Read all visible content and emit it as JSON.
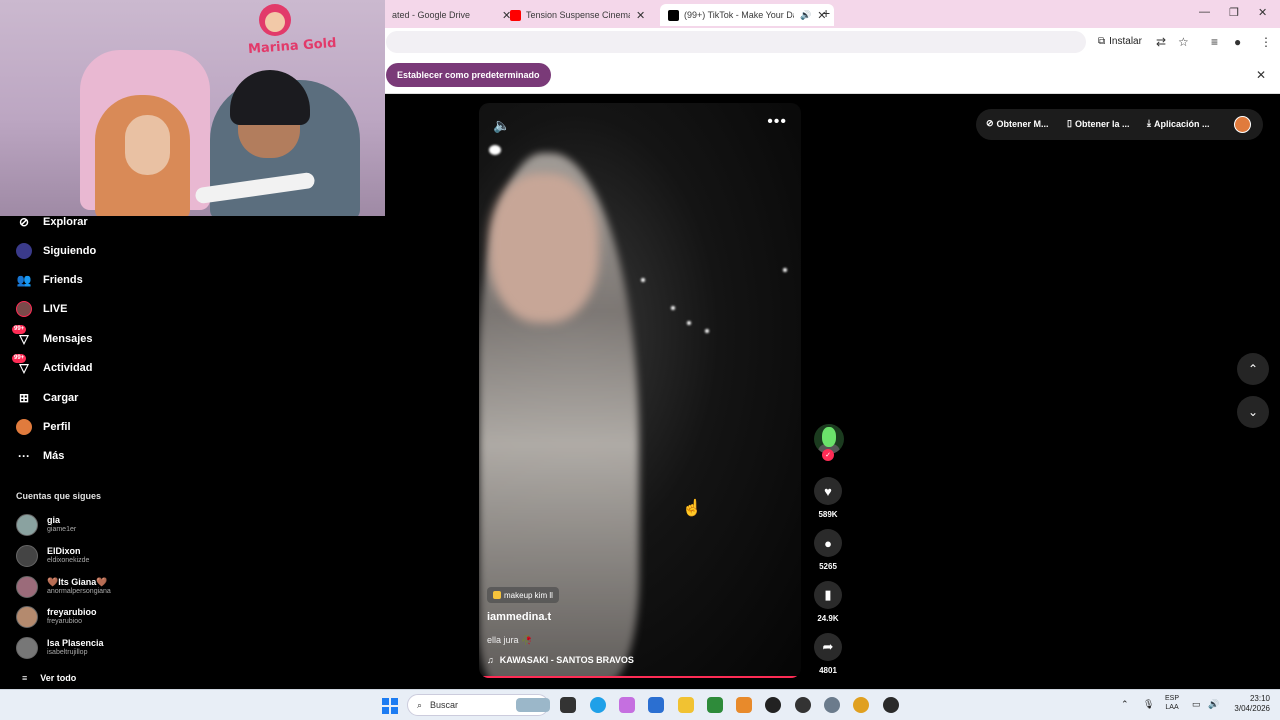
{
  "browser": {
    "tabs": [
      {
        "label": "ated - Google Drive",
        "color": "#f4d7ea"
      },
      {
        "label": "Tension Suspense Cinematic Ne",
        "color": "#ff0000"
      },
      {
        "label": "(99+) TikTok - Make Your Da",
        "color": "#000000",
        "active": true
      }
    ],
    "install_label": "Instalar",
    "infobar_button": "Establecer como predeterminado"
  },
  "webcam": {
    "logo_text": "Marina Gold"
  },
  "sidebar": {
    "items": [
      {
        "label": "Explorar",
        "icon": "compass-icon"
      },
      {
        "label": "Siguiendo",
        "icon": "following-icon"
      },
      {
        "label": "Friends",
        "icon": "friends-icon"
      },
      {
        "label": "LIVE",
        "icon": "live-icon"
      },
      {
        "label": "Mensajes",
        "icon": "message-icon",
        "badge": "99+"
      },
      {
        "label": "Actividad",
        "icon": "activity-icon",
        "badge": "99+"
      },
      {
        "label": "Cargar",
        "icon": "upload-icon"
      },
      {
        "label": "Perfil",
        "icon": "profile-icon"
      },
      {
        "label": "Más",
        "icon": "more-icon"
      }
    ],
    "following_title": "Cuentas que sigues",
    "following": [
      {
        "name": "gia",
        "handle": "giame1er"
      },
      {
        "name": "ElDixon",
        "handle": "eldixonekizde"
      },
      {
        "name": "🤎Its Giana🤎",
        "handle": "anormalpersongiana"
      },
      {
        "name": "freyarubioo",
        "handle": "freyarubioo"
      },
      {
        "name": "Isa Plasencia",
        "handle": "isabeltrujillop"
      }
    ],
    "see_all": "Ver todo"
  },
  "video": {
    "effect": "makeup kim ll",
    "author": "iammedina.t",
    "caption": "ella jura 🥀",
    "music": "KAWASAKI - SANTOS BRAVOS",
    "progress": 1.0
  },
  "actions": {
    "likes": "589K",
    "comments": "5265",
    "saves": "24.9K",
    "shares": "4801"
  },
  "top_pills": {
    "p1": "Obtener M...",
    "p2": "Obtener la ...",
    "p3": "Aplicación ..."
  },
  "taskbar": {
    "search_placeholder": "Buscar",
    "lang_top": "ESP",
    "lang_bottom": "LAA",
    "time": "23:10",
    "date": "3/04/2026"
  },
  "colors": {
    "accent": "#fe2c55",
    "infobar_button": "#7a3a78",
    "tabbar": "#f4d7ea"
  }
}
